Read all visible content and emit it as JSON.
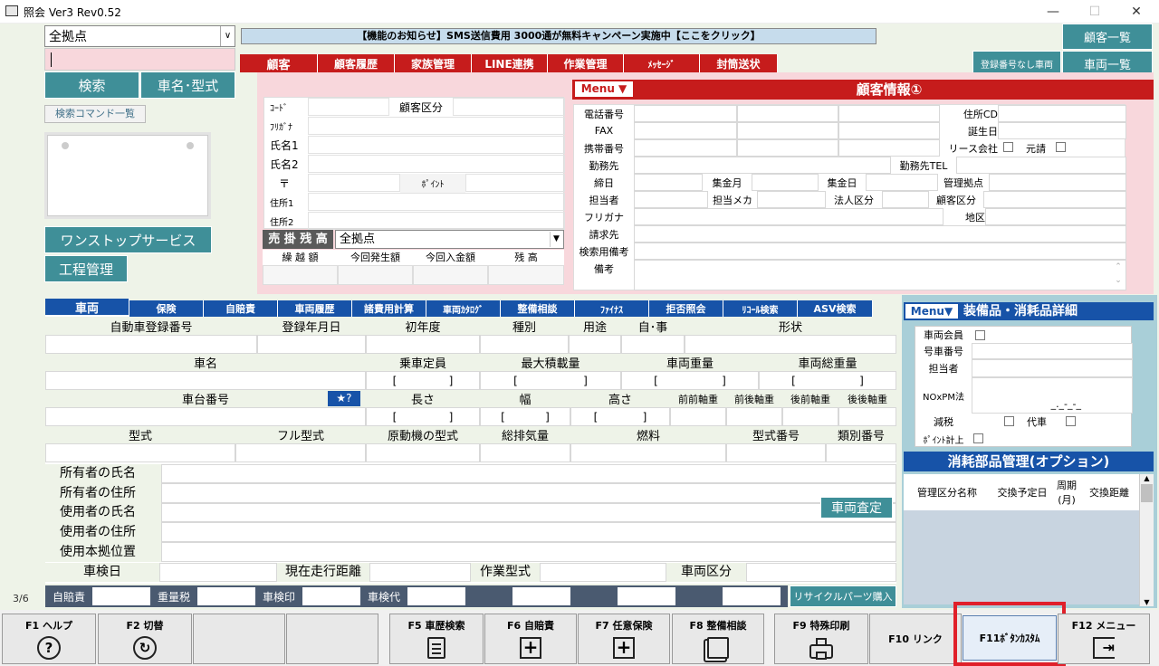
{
  "window": {
    "title": "照会 Ver3 Rev0.52",
    "minimize": "—",
    "maximize": "☐",
    "close": "✕"
  },
  "left": {
    "branch_select": "全拠点",
    "search_button": "検索",
    "model_button": "車名･型式",
    "command_list": "検索コマンド一覧",
    "onestop_button": "ワンストップサービス",
    "process_button": "工程管理"
  },
  "notice": "【機能のお知らせ】SMS送信費用 3000通が無料キャンペーン実施中【ここをクリック】",
  "right_buttons": {
    "customer_list": "顧客一覧",
    "no_plate": "登録番号なし車両",
    "vehicle_list": "車両一覧"
  },
  "customer_tabs": [
    "顧客",
    "顧客履歴",
    "家族管理",
    "LINE連携",
    "作業管理",
    "ﾒｯｾｰｼﾞ",
    "封筒送状"
  ],
  "customer_form": {
    "code": "ｺｰﾄﾞ",
    "category": "顧客区分",
    "furigana": "ﾌﾘｶﾞﾅ",
    "name1": "氏名1",
    "name2": "氏名2",
    "postal": "〒",
    "point": "ﾎﾟｲﾝﾄ",
    "addr1": "住所1",
    "addr2": "住所2",
    "receivable": "売 掛 残 高",
    "receivable_branch": "全拠点",
    "carry": "繰 越 額",
    "current_sales": "今回発生額",
    "current_payment": "今回入金額",
    "balance": "残 高"
  },
  "customer_info": {
    "menu": "Menu ▼",
    "title": "顧客情報①",
    "phone": "電話番号",
    "fax": "FAX",
    "mobile": "携帯番号",
    "work": "勤務先",
    "address_cd": "住所CD",
    "birthday": "誕生日",
    "lease": "リース会社",
    "original": "元請",
    "work_tel": "勤務先TEL",
    "closing": "締日",
    "collect_month": "集金月",
    "collect_day": "集金日",
    "managing_base": "管理拠点",
    "staff": "担当者",
    "maker": "担当メカ",
    "corp_class": "法人区分",
    "cust_class": "顧客区分",
    "furigana": "フリガナ",
    "area": "地区",
    "billing": "請求先",
    "search_note": "検索用備考",
    "note": "備考"
  },
  "vehicle_tabs": [
    "車両",
    "保険",
    "自賠責",
    "車両履歴",
    "諸費用計算",
    "車両ｶﾀﾛｸﾞ",
    "整備相談",
    "ﾌｧｲﾅｽ",
    "拒否照会",
    "ﾘｺｰﾙ検索",
    "ASV検索"
  ],
  "vehicle": {
    "row1": [
      "自動車登録番号",
      "登録年月日",
      "初年度",
      "種別",
      "用途",
      "自･事",
      "形状"
    ],
    "row2": [
      "車名",
      "乗車定員",
      "最大積載量",
      "車両重量",
      "車両総重量"
    ],
    "row3": [
      "車台番号",
      "長さ",
      "幅",
      "高さ",
      "前前軸重",
      "前後軸重",
      "後前軸重",
      "後後軸重"
    ],
    "row4": [
      "型式",
      "フル型式",
      "原動機の型式",
      "総排気量",
      "燃料",
      "型式番号",
      "類別番号"
    ],
    "owner_name": "所有者の氏名",
    "owner_addr": "所有者の住所",
    "user_name": "使用者の氏名",
    "user_addr": "使用者の住所",
    "base_loc": "使用本拠位置",
    "inspection_date": "車検日",
    "mileage": "現在走行距離",
    "work_type": "作業型式",
    "vehicle_class": "車両区分",
    "appraisal": "車両査定",
    "fees": [
      "自賠責",
      "重量税",
      "車検印",
      "車検代"
    ],
    "recycle": "リサイクルパーツ購入",
    "page": "3/6"
  },
  "equipment": {
    "menu": "Menu▼",
    "title": "装備品・消耗品詳細",
    "member": "車両会員",
    "car_no": "号車番号",
    "staff": "担当者",
    "nox": "NOxPM法",
    "tax_cut": "減税",
    "substitute": "代車",
    "point": "ﾎﾟｲﾝﾄ計上",
    "nox_value": "_._-_-_",
    "parts_title": "消耗部品管理(オプション)",
    "cols": [
      "管理区分名称",
      "交換予定日",
      "周期(月)",
      "交換距離"
    ]
  },
  "fkeys": [
    {
      "label": "F1 ヘルプ",
      "icon": "?"
    },
    {
      "label": "F2 切替",
      "icon": "↻"
    },
    {
      "label": "",
      "icon": ""
    },
    {
      "label": "",
      "icon": ""
    },
    {
      "label": "F5 車歴検索",
      "icon": "📋"
    },
    {
      "label": "F6 自賠責",
      "icon": "+"
    },
    {
      "label": "F7 任意保険",
      "icon": "+"
    },
    {
      "label": "F8 整備相談",
      "icon": "▤"
    },
    {
      "label": "F9 特殊印刷",
      "icon": "⎙"
    },
    {
      "label": "F10 リンク",
      "icon": ""
    },
    {
      "label": "F11ﾎﾞﾀﾝｶｽﾀﾑ",
      "icon": ""
    },
    {
      "label": "F12 メニュー",
      "icon": "⇥"
    }
  ],
  "colors": {
    "teal": "#3f8f98",
    "red": "#c61c1c",
    "blue": "#1753a8",
    "highlight": "#e0202a"
  }
}
